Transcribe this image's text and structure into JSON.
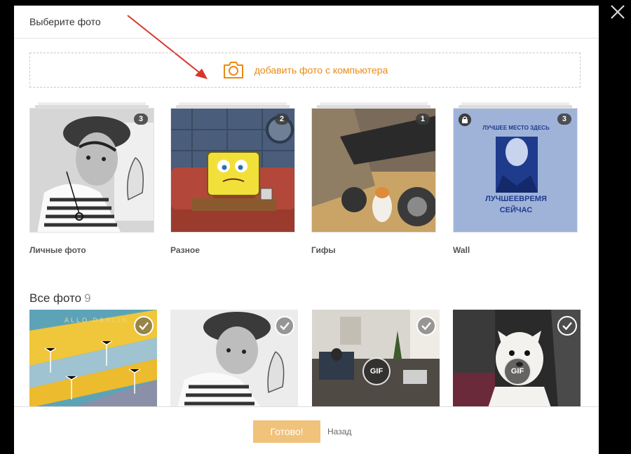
{
  "dialog": {
    "title": "Выберите фото",
    "upload_label": "добавить фото с компьютера",
    "accent_color": "#eb8a12"
  },
  "albums": [
    {
      "name": "Личные фото",
      "count": "3",
      "locked": false
    },
    {
      "name": "Разное",
      "count": "2",
      "locked": false
    },
    {
      "name": "Гифы",
      "count": "1",
      "locked": false
    },
    {
      "name": "Wall",
      "count": "3",
      "locked": true
    }
  ],
  "wall_poster": {
    "top_text": "ЛУЧШЕЕ МЕСТО ЗДЕСЬ",
    "bottom_line1": "ЛУЧШЕЕВРЕМЯ",
    "bottom_line2": "СЕЙЧАС"
  },
  "poster_tile_text": "ALLO DARLIN",
  "all_photos": {
    "title": "Все фото",
    "count": "9"
  },
  "photos": [
    {
      "kind": "image",
      "gif_label": ""
    },
    {
      "kind": "image",
      "gif_label": ""
    },
    {
      "kind": "gif",
      "gif_label": "GIF"
    },
    {
      "kind": "gif",
      "gif_label": "GIF"
    }
  ],
  "footer": {
    "done_label": "Готово!",
    "back_label": "Назад"
  }
}
